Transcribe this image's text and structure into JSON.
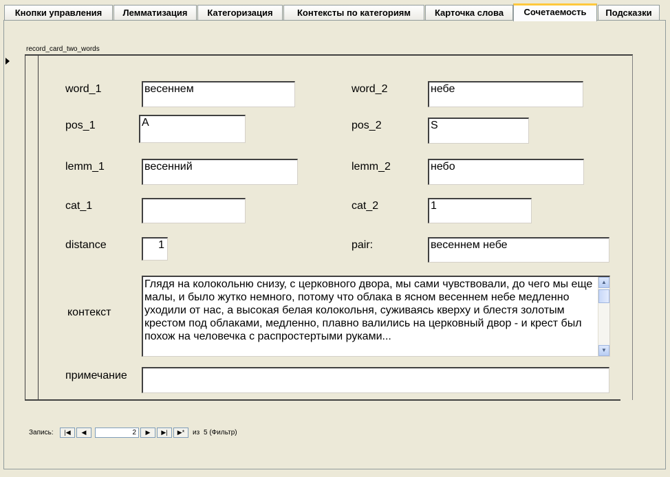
{
  "tabs": [
    {
      "label": "Кнопки управления"
    },
    {
      "label": "Лемматизация"
    },
    {
      "label": "Категоризация"
    },
    {
      "label": "Контексты по категориям"
    },
    {
      "label": "Карточка слова"
    },
    {
      "label": "Сочетаемость"
    },
    {
      "label": "Подсказки"
    }
  ],
  "active_tab": "Сочетаемость",
  "form": {
    "caption": "record_card_two_words",
    "fields": {
      "word_1": {
        "label": "word_1",
        "value": "весеннем"
      },
      "word_2": {
        "label": "word_2",
        "value": "небе"
      },
      "pos_1": {
        "label": "pos_1",
        "value": "A"
      },
      "pos_2": {
        "label": "pos_2",
        "value": "S"
      },
      "lemm_1": {
        "label": "lemm_1",
        "value": "весенний"
      },
      "lemm_2": {
        "label": "lemm_2",
        "value": "небо"
      },
      "cat_1": {
        "label": "cat_1",
        "value": ""
      },
      "cat_2": {
        "label": "cat_2",
        "value": "1"
      },
      "distance": {
        "label": "distance",
        "value": "1"
      },
      "pair": {
        "label": "pair:",
        "value": "весеннем небе"
      },
      "context": {
        "label": "контекст",
        "value": "Глядя на колокольню снизу, с церковного двора, мы сами чувствовали, до чего мы еще малы, и было жутко немного, потому что облака в ясном весеннем небе медленно уходили от нас, а высокая белая колокольня, суживаясь кверху и блестя золотым крестом под облаками, медленно, плавно валились на церковный двор - и крест был похож на человечка с распростертыми руками..."
      },
      "note": {
        "label": "примечание",
        "value": ""
      }
    }
  },
  "navigator": {
    "label": "Запись:",
    "current": "2",
    "of_label": "из",
    "total": "5 (Фильтр)"
  },
  "colors": {
    "background": "#ece9d8",
    "active_tab_accent": "#ffc83c",
    "field_bg": "#ffffff"
  }
}
